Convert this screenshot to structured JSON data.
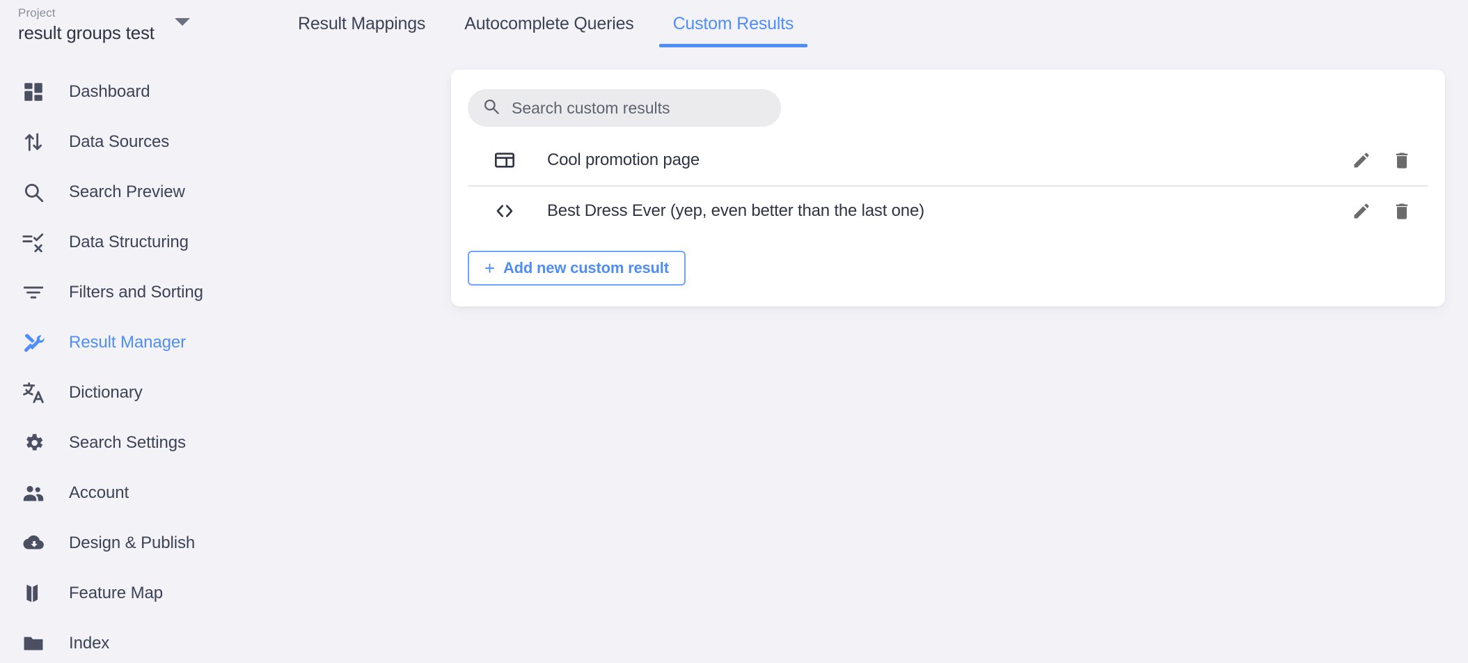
{
  "colors": {
    "accent": "#4f8df9",
    "text": "#3c4257",
    "muted": "#8a8f9e",
    "page_bg": "#f3f3f7",
    "card_bg": "#ffffff",
    "search_bg": "#ebebed",
    "divider": "#e4e5e9"
  },
  "project": {
    "label": "Project",
    "name": "result groups test",
    "caret_icon": "chevron-down-icon"
  },
  "sidebar": {
    "items": [
      {
        "label": "Dashboard",
        "icon": "dashboard-icon",
        "active": false
      },
      {
        "label": "Data Sources",
        "icon": "import-export-icon",
        "active": false
      },
      {
        "label": "Search Preview",
        "icon": "search-icon",
        "active": false
      },
      {
        "label": "Data Structuring",
        "icon": "rule-icon",
        "active": false
      },
      {
        "label": "Filters and Sorting",
        "icon": "filter-icon",
        "active": false
      },
      {
        "label": "Result Manager",
        "icon": "tools-icon",
        "active": true
      },
      {
        "label": "Dictionary",
        "icon": "translate-icon",
        "active": false
      },
      {
        "label": "Search Settings",
        "icon": "gear-icon",
        "active": false
      },
      {
        "label": "Account",
        "icon": "people-icon",
        "active": false
      },
      {
        "label": "Design & Publish",
        "icon": "cloud-download-icon",
        "active": false
      },
      {
        "label": "Feature Map",
        "icon": "map-icon",
        "active": false
      },
      {
        "label": "Index",
        "icon": "folder-icon",
        "active": false
      }
    ]
  },
  "tabs": [
    {
      "label": "Result Mappings",
      "active": false
    },
    {
      "label": "Autocomplete Queries",
      "active": false
    },
    {
      "label": "Custom Results",
      "active": true
    }
  ],
  "main": {
    "search": {
      "placeholder": "Search custom results",
      "value": "",
      "icon": "search-icon"
    },
    "results": [
      {
        "title": "Cool promotion page",
        "type_icon": "web-asset-icon",
        "edit_icon": "pencil-icon",
        "delete_icon": "trash-icon"
      },
      {
        "title": "Best Dress Ever (yep, even better than the last one)",
        "type_icon": "code-icon",
        "edit_icon": "pencil-icon",
        "delete_icon": "trash-icon"
      }
    ],
    "add_button": {
      "plus": "+",
      "label": "Add new custom result"
    }
  }
}
